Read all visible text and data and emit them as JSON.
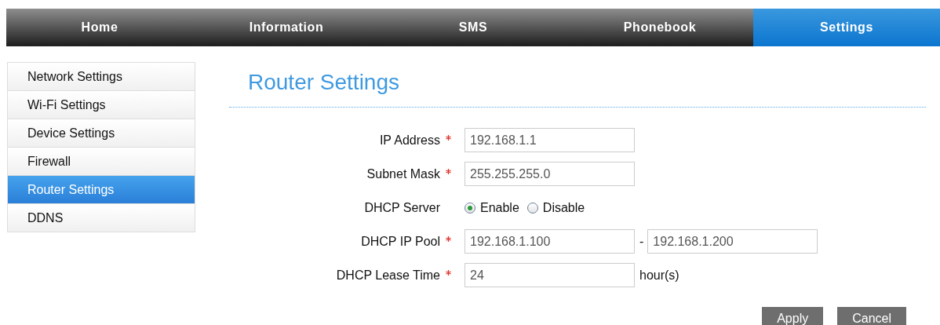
{
  "tabs": [
    {
      "label": "Home",
      "selected": false
    },
    {
      "label": "Information",
      "selected": false
    },
    {
      "label": "SMS",
      "selected": false
    },
    {
      "label": "Phonebook",
      "selected": false
    },
    {
      "label": "Settings",
      "selected": true
    }
  ],
  "sidebar": {
    "items": [
      {
        "label": "Network Settings",
        "selected": false
      },
      {
        "label": "Wi-Fi Settings",
        "selected": false
      },
      {
        "label": "Device Settings",
        "selected": false
      },
      {
        "label": "Firewall",
        "selected": false
      },
      {
        "label": "Router Settings",
        "selected": true
      },
      {
        "label": "DDNS",
        "selected": false
      }
    ]
  },
  "page_title": "Router Settings",
  "form": [
    {
      "kind": "text",
      "label": "IP Address",
      "required": true,
      "value": "192.168.1.1"
    },
    {
      "kind": "text",
      "label": "Subnet Mask",
      "required": true,
      "value": "255.255.255.0"
    },
    {
      "kind": "radio",
      "label": "DHCP Server",
      "required": false,
      "options": [
        {
          "label": "Enable",
          "selected": true
        },
        {
          "label": "Disable",
          "selected": false
        }
      ]
    },
    {
      "kind": "range",
      "label": "DHCP IP Pool",
      "required": true,
      "value": "192.168.1.100",
      "separator": "-",
      "value_to": "192.168.1.200"
    },
    {
      "kind": "unit",
      "label": "DHCP Lease Time",
      "required": true,
      "value": "24",
      "unit": "hour(s)"
    }
  ],
  "buttons": [
    "Apply",
    "Cancel"
  ]
}
